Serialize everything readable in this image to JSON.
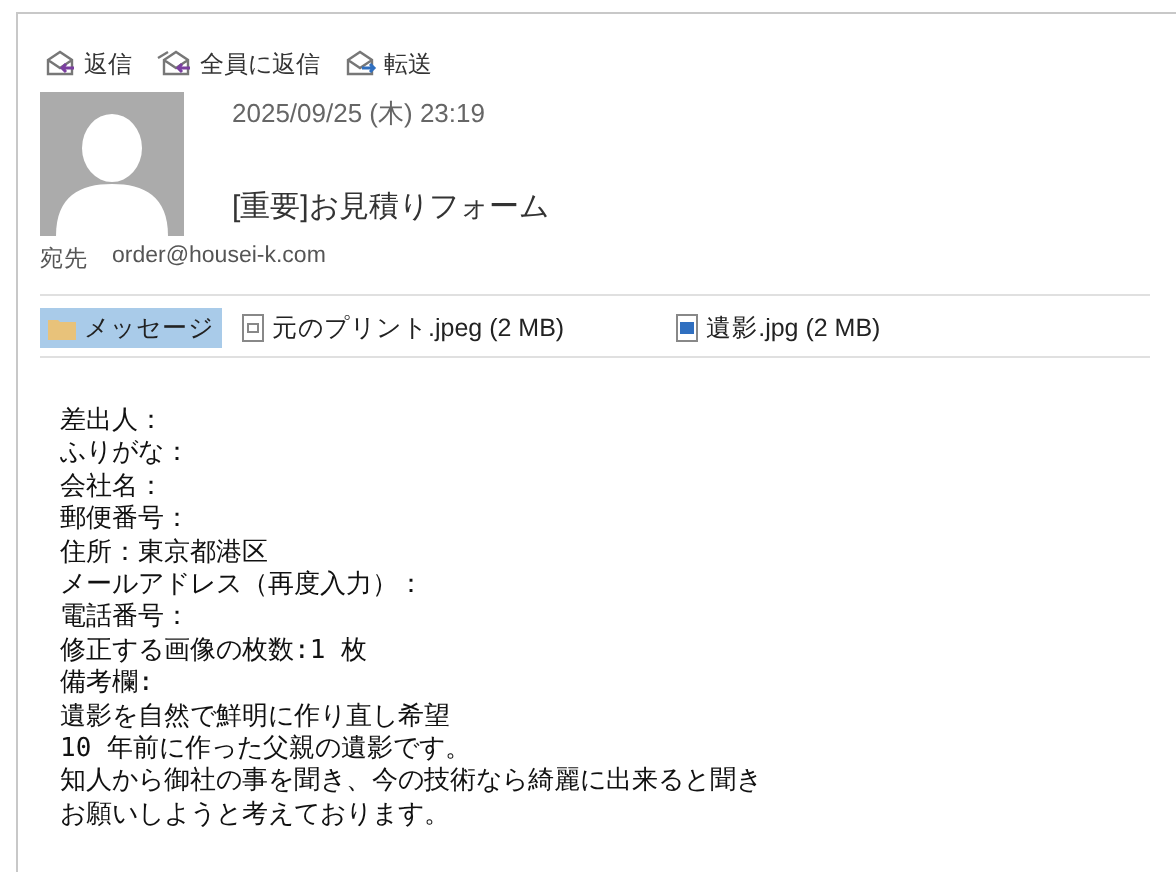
{
  "toolbar": [
    {
      "kind": "reply",
      "label": "返信"
    },
    {
      "kind": "reply_all",
      "label": "全員に返信"
    },
    {
      "kind": "forward",
      "label": "転送"
    }
  ],
  "header": {
    "date": "2025/09/25 (木) 23:19",
    "subject": "[重要]お見積りフォーム",
    "to_label": "宛先",
    "to": "order@housei-k.com"
  },
  "attachments": [
    {
      "kind": "message",
      "label": "メッセージ",
      "selected": true
    },
    {
      "kind": "document",
      "label": "元のプリント.jpeg (2 MB)",
      "selected": false
    },
    {
      "kind": "image",
      "label": "遺影.jpg (2 MB)",
      "selected": false
    }
  ],
  "body": [
    "差出人：",
    "ふりがな：",
    "会社名：",
    "郵便番号：",
    "住所：東京都港区",
    "メールアドレス（再度入力）：",
    "電話番号：",
    "修正する画像の枚数:1 枚",
    "備考欄:",
    "遺影を自然で鮮明に作り直し希望",
    "10 年前に作った父親の遺影です。",
    "知人から御社の事を聞き、今の技術なら綺麗に出来ると聞き",
    "お願いしようと考えております。"
  ]
}
